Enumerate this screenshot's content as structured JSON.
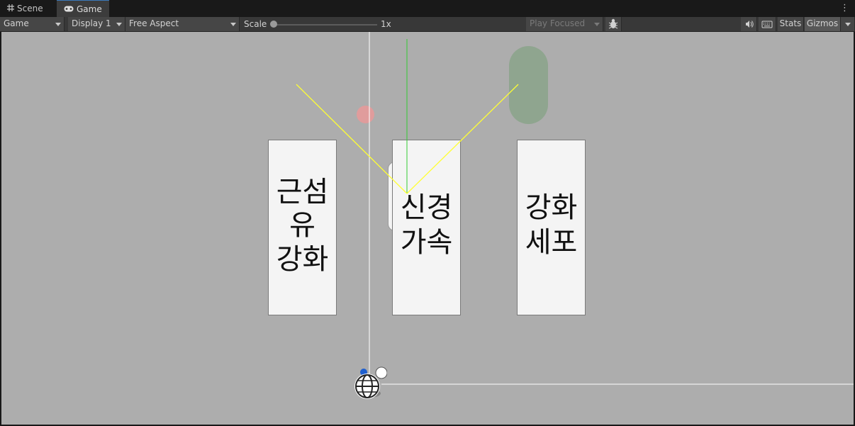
{
  "tabs": [
    {
      "label": "Scene",
      "icon": "grid-icon"
    },
    {
      "label": "Game",
      "icon": "gamepad-icon"
    }
  ],
  "toolbar": {
    "display_mode": "Game",
    "display": "Display 1",
    "aspect": "Free Aspect",
    "scale_label": "Scale",
    "scale_value": "1x",
    "scale_fraction": 0,
    "play_mode": "Play Focused",
    "stats_label": "Stats",
    "gizmos_label": "Gizmos"
  },
  "cards": [
    {
      "lines": [
        "근섬",
        "유",
        "강화"
      ]
    },
    {
      "lines": [
        "신경",
        "가속"
      ]
    },
    {
      "lines": [
        "강화",
        "세포"
      ]
    }
  ],
  "colors": {
    "viewport_bg": "#adadad",
    "card_bg": "#f4f4f4",
    "yellow_line": "#ffff33",
    "green_line": "#33cc33",
    "red_dot": "#e59a9a",
    "capsule": "#8fa58f",
    "tab_accent": "#3a79bb"
  }
}
